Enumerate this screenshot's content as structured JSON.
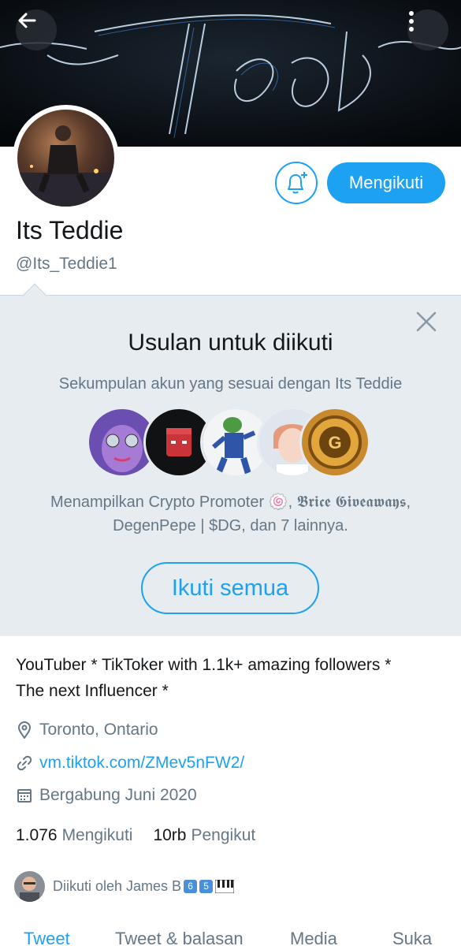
{
  "header": {
    "back_icon": "arrow-left-icon",
    "more_icon": "more-vertical-icon"
  },
  "profile": {
    "display_name": "Its Teddie",
    "handle": "@Its_Teddie1",
    "follow_button": "Mengikuti",
    "notify_icon": "bell-plus-icon"
  },
  "suggestions": {
    "title": "Usulan untuk diikuti",
    "subtitle": "Sekumpulan akun yang sesuai dengan Its Teddie",
    "showing_line1": "Menampilkan Crypto Promoter 🍥, 𝕭𝖗𝖎𝖈𝖊 𝕲𝖎𝖛𝖊𝖆𝖜𝖆𝖞𝖘,",
    "showing_line2": "DegenPepe | $DG, dan 7 lainnya.",
    "follow_all_button": "Ikuti semua",
    "close_icon": "close-icon"
  },
  "bio": {
    "text_line1": "YouTuber * TikToker with 1.1k+ amazing followers *",
    "text_line2": "The next Influencer *",
    "location": "Toronto, Ontario",
    "website": "vm.tiktok.com/ZMev5nFW2/",
    "joined": "Bergabung Juni 2020"
  },
  "stats": {
    "following_count": "1.076",
    "following_label": "Mengikuti",
    "followers_count": "10rb",
    "followers_label": "Pengikut"
  },
  "followed_by": {
    "text": "Diikuti oleh James B",
    "badge1": "6",
    "badge2": "5"
  },
  "tabs": [
    "Tweet",
    "Tweet & balasan",
    "Media",
    "Suka"
  ],
  "colors": {
    "accent": "#1da1f2",
    "secondary_text": "#657786",
    "panel_bg": "#e6ecf0"
  }
}
